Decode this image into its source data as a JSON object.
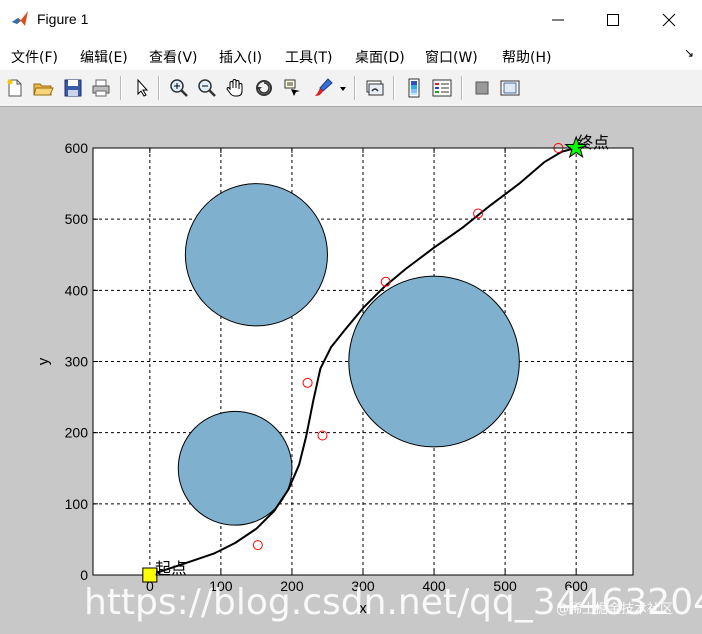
{
  "window": {
    "title": "Figure 1",
    "minimize_glyph": "minimize-icon",
    "maximize_glyph": "maximize-icon",
    "close_glyph": "close-icon"
  },
  "menu": {
    "items": [
      "文件(F)",
      "编辑(E)",
      "查看(V)",
      "插入(I)",
      "工具(T)",
      "桌面(D)",
      "窗口(W)",
      "帮助(H)"
    ],
    "overflow_glyph": "↘"
  },
  "toolbar": {
    "icons": [
      "new-figure-icon",
      "open-file-icon",
      "save-icon",
      "print-icon",
      "pointer-icon",
      "zoom-in-icon",
      "zoom-out-icon",
      "pan-hand-icon",
      "rotate-3d-icon",
      "data-cursor-icon",
      "brush-icon",
      "link-plot-icon",
      "colorbar-icon",
      "legend-icon",
      "hide-plot-tools-icon",
      "show-plot-tools-icon"
    ]
  },
  "chart_data": {
    "type": "line",
    "xlabel": "x",
    "ylabel": "y",
    "xlim": [
      -80,
      680
    ],
    "ylim": [
      0,
      600
    ],
    "xticks": [
      0,
      100,
      200,
      300,
      400,
      500,
      600
    ],
    "yticks": [
      0,
      100,
      200,
      300,
      400,
      500,
      600
    ],
    "grid": true,
    "grid_style": "dashed",
    "colors": {
      "obstacle_fill": "#7fb0cd",
      "path": "#000000",
      "waypoint": "#ff0000",
      "start_marker": "#ffff00",
      "goal_marker": "#00ff00",
      "background": "#c8c8c8"
    },
    "obstacles": [
      {
        "cx": 150,
        "cy": 450,
        "r": 100
      },
      {
        "cx": 120,
        "cy": 150,
        "r": 80
      },
      {
        "cx": 400,
        "cy": 300,
        "r": 120
      }
    ],
    "path": {
      "x": [
        0,
        30,
        60,
        90,
        120,
        150,
        175,
        195,
        210,
        220,
        230,
        240,
        255,
        275,
        300,
        330,
        360,
        400,
        440,
        480,
        520,
        555,
        580,
        600
      ],
      "y": [
        0,
        10,
        20,
        30,
        45,
        65,
        90,
        120,
        155,
        195,
        245,
        290,
        320,
        345,
        375,
        405,
        430,
        460,
        488,
        520,
        550,
        580,
        595,
        600
      ]
    },
    "waypoints": {
      "x": [
        152,
        222,
        243,
        332,
        462,
        575
      ],
      "y": [
        42,
        270,
        196,
        412,
        508,
        600
      ]
    },
    "start": {
      "x": 0,
      "y": 0,
      "label": "起点"
    },
    "goal": {
      "x": 600,
      "y": 600,
      "label": "终点"
    }
  },
  "watermark": {
    "text": "https://blog.csdn.net/qq_34463204",
    "secondary": "@稀土掘金技术社区"
  }
}
